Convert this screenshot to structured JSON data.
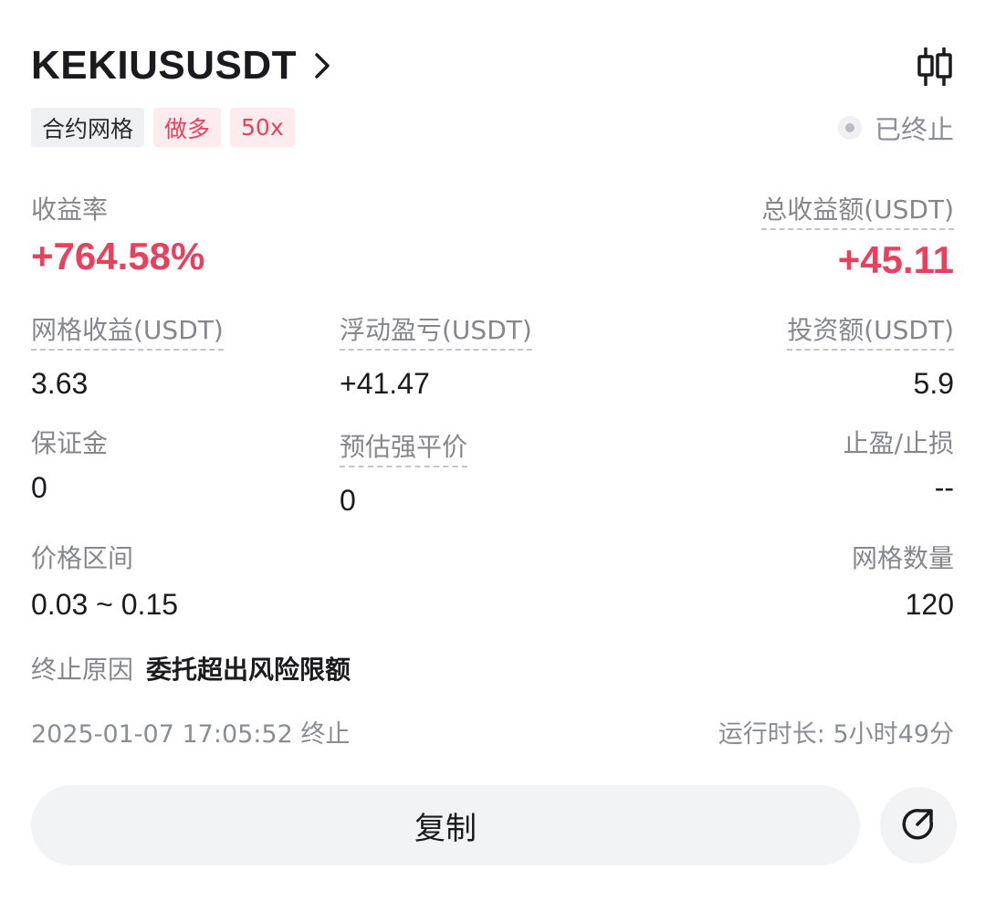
{
  "header": {
    "title": "KEKIUSUSDT",
    "chevron_icon": "chevron-right-icon",
    "kline_icon": "candlestick-chart-icon"
  },
  "tags": [
    {
      "label": "合约网格",
      "style": "neutral"
    },
    {
      "label": "做多",
      "style": "red"
    },
    {
      "label": "50x",
      "style": "red"
    }
  ],
  "status": {
    "label": "已终止"
  },
  "summary": {
    "yield_label": "收益率",
    "yield_value": "+764.58%",
    "total_profit_label": "总收益额(USDT)",
    "total_profit_value": "+45.11"
  },
  "stats": {
    "grid_profit_label": "网格收益(USDT)",
    "grid_profit_value": "3.63",
    "floating_pnl_label": "浮动盈亏(USDT)",
    "floating_pnl_value": "+41.47",
    "investment_label": "投资额(USDT)",
    "investment_value": "5.9",
    "margin_label": "保证金",
    "margin_value": "0",
    "liq_price_label": "预估强平价",
    "liq_price_value": "0",
    "tpsl_label": "止盈/止损",
    "tpsl_value": "--",
    "price_range_label": "价格区间",
    "price_range_value": "0.03 ~ 0.15",
    "grid_count_label": "网格数量",
    "grid_count_value": "120"
  },
  "reason": {
    "label": "终止原因",
    "value": "委托超出风险限额"
  },
  "footer": {
    "terminated_time": "2025-01-07 17:05:52 终止",
    "runtime": "运行时长: 5小时49分"
  },
  "actions": {
    "copy_label": "复制",
    "share_icon": "share-external-icon"
  },
  "colors": {
    "accent_red": "#e8415e",
    "muted_text": "#85878d",
    "button_bg": "#f2f3f5"
  }
}
